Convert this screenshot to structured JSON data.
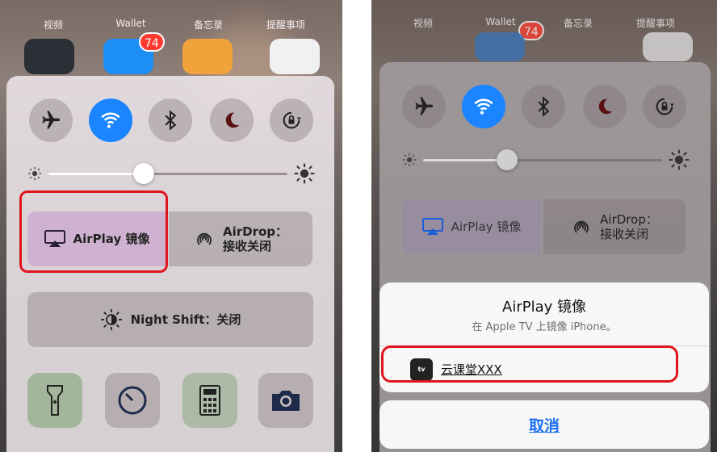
{
  "home_labels": [
    "视频",
    "Wallet",
    "备忘录",
    "提醒事项"
  ],
  "app_badge": "74",
  "left": {
    "airplay_label": "AirPlay 镜像",
    "airdrop_line1": "AirDrop：",
    "airdrop_line2": "接收关闭",
    "night_shift_label": "Night Shift：关闭",
    "brightness_level": 0.4
  },
  "right": {
    "airplay_label": "AirPlay 镜像",
    "airdrop_line1": "AirDrop：",
    "airdrop_line2": "接收关闭",
    "brightness_level": 0.35,
    "sheet_title": "AirPlay 镜像",
    "sheet_subtitle": "在 Apple TV 上镜像 iPhone。",
    "device_name": "云课堂XXX",
    "device_icon_text": "tv",
    "cancel_label": "取消"
  },
  "colors": {
    "accent_blue": "#1a85ff",
    "highlight_red": "#e0141e",
    "cancel_blue": "#1a6ff2"
  },
  "icons": [
    "airplane-icon",
    "wifi-icon",
    "bluetooth-icon",
    "moon-icon",
    "rotation-lock-icon",
    "sun-small-icon",
    "sun-large-icon",
    "airplay-icon",
    "airdrop-icon",
    "night-shift-icon",
    "flashlight-icon",
    "timer-icon",
    "calculator-icon",
    "camera-icon",
    "appletv-icon"
  ]
}
